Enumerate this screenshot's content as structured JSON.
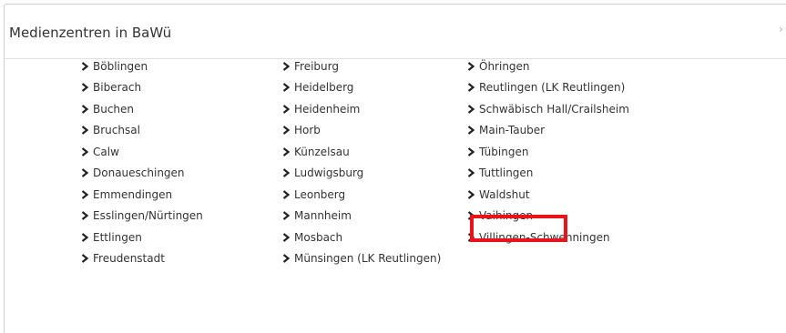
{
  "panel": {
    "title": "Medienzentren in BaWü",
    "close_glyph": "›"
  },
  "icons": {
    "item_icon": "chevron-right-icon",
    "close_icon": "chevron-right-icon"
  },
  "colors": {
    "highlight": "#e8141c",
    "text": "#333333"
  },
  "columns": [
    {
      "items": [
        "Böblingen",
        "Biberach",
        "Buchen",
        "Bruchsal",
        "Calw",
        "Donaueschingen",
        "Emmendingen",
        "Esslingen/Nürtingen",
        "Ettlingen",
        "Freudenstadt"
      ]
    },
    {
      "items": [
        "Freiburg",
        "Heidelberg",
        "Heidenheim",
        "Horb",
        "Künzelsau",
        "Ludwigsburg",
        "Leonberg",
        "Mannheim",
        "Mosbach",
        "Münsingen (LK Reutlingen)"
      ]
    },
    {
      "items": [
        "Öhringen",
        "Reutlingen (LK Reutlingen)",
        "Schwäbisch Hall/Crailsheim",
        "Main-Tauber",
        "Tübingen",
        "Tuttlingen",
        "Waldshut",
        "Vaihingen",
        "Villingen-Schwenningen"
      ]
    }
  ],
  "highlighted_item": "Waldshut"
}
